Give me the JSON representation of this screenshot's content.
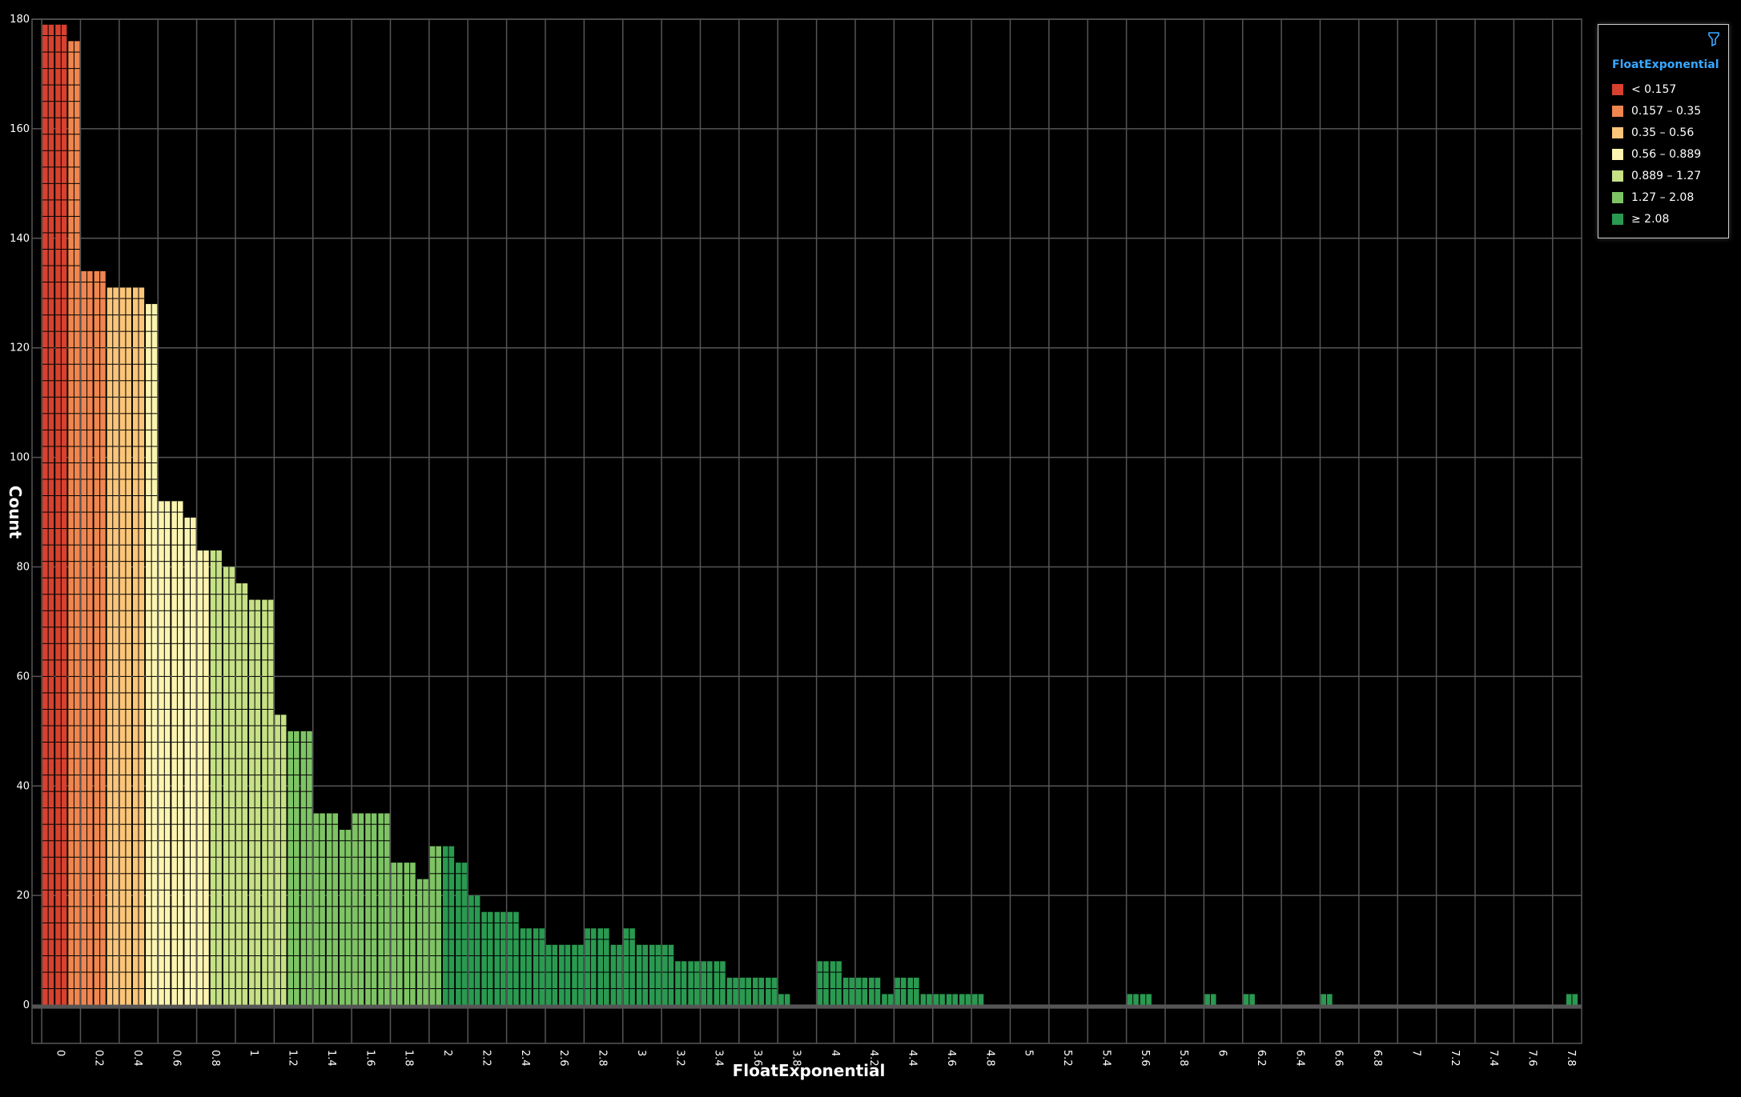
{
  "chart_data": {
    "type": "bar",
    "title": "",
    "xlabel": "FloatExponential",
    "ylabel": "Count",
    "xlim": [
      -0.05,
      7.95
    ],
    "ylim": [
      -7,
      180
    ],
    "bin_width": 0.2,
    "grid": true,
    "legend_position": "top-right",
    "x_ticks": [
      "0",
      "0.2",
      "0.4",
      "0.6",
      "0.8",
      "1",
      "1.2",
      "1.4",
      "1.6",
      "1.8",
      "2",
      "2.2",
      "2.4",
      "2.6",
      "2.8",
      "3",
      "3.2",
      "3.4",
      "3.6",
      "3.8",
      "4",
      "4.2",
      "4.4",
      "4.6",
      "4.8",
      "5",
      "5.2",
      "5.4",
      "5.6",
      "5.8",
      "6",
      "6.2",
      "6.4",
      "6.6",
      "6.8",
      "7",
      "7.2",
      "7.4",
      "7.6",
      "7.8"
    ],
    "y_ticks": [
      0,
      20,
      40,
      60,
      80,
      100,
      120,
      140,
      160,
      180
    ],
    "bins": [
      {
        "x0": 0.0,
        "x1": 0.2,
        "counts": [
          179,
          179,
          176
        ]
      },
      {
        "x0": 0.2,
        "x1": 0.4,
        "counts": [
          134,
          134,
          131
        ]
      },
      {
        "x0": 0.4,
        "x1": 0.6,
        "counts": [
          131,
          131,
          128
        ]
      },
      {
        "x0": 0.6,
        "x1": 0.8,
        "counts": [
          92,
          92,
          89
        ]
      },
      {
        "x0": 0.8,
        "x1": 1.0,
        "counts": [
          83,
          83,
          80
        ]
      },
      {
        "x0": 1.0,
        "x1": 1.2,
        "counts": [
          77,
          74,
          74
        ]
      },
      {
        "x0": 1.2,
        "x1": 1.4,
        "counts": [
          53,
          50,
          50
        ]
      },
      {
        "x0": 1.4,
        "x1": 1.6,
        "counts": [
          35,
          35,
          32
        ]
      },
      {
        "x0": 1.6,
        "x1": 1.8,
        "counts": [
          35,
          35,
          35
        ]
      },
      {
        "x0": 1.8,
        "x1": 2.0,
        "counts": [
          26,
          26,
          23
        ]
      },
      {
        "x0": 2.0,
        "x1": 2.2,
        "counts": [
          29,
          29,
          26
        ]
      },
      {
        "x0": 2.2,
        "x1": 2.4,
        "counts": [
          20,
          17,
          17
        ]
      },
      {
        "x0": 2.4,
        "x1": 2.6,
        "counts": [
          17,
          14,
          14
        ]
      },
      {
        "x0": 2.6,
        "x1": 2.8,
        "counts": [
          11,
          11,
          11
        ]
      },
      {
        "x0": 2.8,
        "x1": 3.0,
        "counts": [
          14,
          14,
          11
        ]
      },
      {
        "x0": 3.0,
        "x1": 3.2,
        "counts": [
          14,
          11,
          11
        ]
      },
      {
        "x0": 3.2,
        "x1": 3.4,
        "counts": [
          11,
          8,
          8
        ]
      },
      {
        "x0": 3.4,
        "x1": 3.6,
        "counts": [
          8,
          8,
          5
        ]
      },
      {
        "x0": 3.6,
        "x1": 3.8,
        "counts": [
          5,
          5,
          5
        ]
      },
      {
        "x0": 3.8,
        "x1": 4.0,
        "counts": [
          2,
          0,
          0
        ]
      },
      {
        "x0": 4.0,
        "x1": 4.2,
        "counts": [
          8,
          8,
          5
        ]
      },
      {
        "x0": 4.2,
        "x1": 4.4,
        "counts": [
          5,
          5,
          2
        ]
      },
      {
        "x0": 4.4,
        "x1": 4.6,
        "counts": [
          5,
          5,
          2
        ]
      },
      {
        "x0": 4.6,
        "x1": 4.8,
        "counts": [
          2,
          2,
          2
        ]
      },
      {
        "x0": 4.8,
        "x1": 5.0,
        "counts": [
          2,
          0,
          0
        ]
      },
      {
        "x0": 5.0,
        "x1": 5.2,
        "counts": [
          0,
          0,
          0
        ]
      },
      {
        "x0": 5.2,
        "x1": 5.4,
        "counts": [
          0,
          0,
          0
        ]
      },
      {
        "x0": 5.4,
        "x1": 5.6,
        "counts": [
          0,
          0,
          0
        ]
      },
      {
        "x0": 5.6,
        "x1": 5.8,
        "counts": [
          2,
          2,
          0
        ]
      },
      {
        "x0": 5.8,
        "x1": 6.0,
        "counts": [
          0,
          0,
          0
        ]
      },
      {
        "x0": 6.0,
        "x1": 6.2,
        "counts": [
          2,
          0,
          0
        ]
      },
      {
        "x0": 6.2,
        "x1": 6.4,
        "counts": [
          2,
          0,
          0
        ]
      },
      {
        "x0": 6.4,
        "x1": 6.6,
        "counts": [
          0,
          0,
          0
        ]
      },
      {
        "x0": 6.6,
        "x1": 6.8,
        "counts": [
          2,
          0,
          0
        ]
      },
      {
        "x0": 6.8,
        "x1": 7.0,
        "counts": [
          0,
          0,
          0
        ]
      },
      {
        "x0": 7.0,
        "x1": 7.2,
        "counts": [
          0,
          0,
          0
        ]
      },
      {
        "x0": 7.2,
        "x1": 7.4,
        "counts": [
          0,
          0,
          0
        ]
      },
      {
        "x0": 7.4,
        "x1": 7.6,
        "counts": [
          0,
          0,
          0
        ]
      },
      {
        "x0": 7.6,
        "x1": 7.8,
        "counts": [
          0,
          0,
          0
        ]
      },
      {
        "x0": 7.8,
        "x1": 8.0,
        "counts": [
          0,
          2,
          0
        ]
      }
    ],
    "legend": {
      "title": "FloatExponential",
      "items": [
        {
          "label": "< 0.157",
          "color": "#d7412f",
          "min": null,
          "max": 0.157
        },
        {
          "label": "0.157 – 0.35",
          "color": "#f0864f",
          "min": 0.157,
          "max": 0.35
        },
        {
          "label": "0.35 – 0.56",
          "color": "#fbc57a",
          "min": 0.35,
          "max": 0.56
        },
        {
          "label": "0.56 – 0.889",
          "color": "#fcf4b0",
          "min": 0.56,
          "max": 0.889
        },
        {
          "label": "0.889 – 1.27",
          "color": "#c6e186",
          "min": 0.889,
          "max": 1.27
        },
        {
          "label": "1.27 – 2.08",
          "color": "#7ec465",
          "min": 1.27,
          "max": 2.08
        },
        {
          "label": "≥ 2.08",
          "color": "#2a9a51",
          "min": 2.08,
          "max": null
        }
      ]
    }
  },
  "colors": {
    "background": "#000000",
    "grid": "#555555",
    "cell_border": "#000000",
    "baseline": "#555555",
    "legend_title": "#3aa8ff",
    "filter_icon": "#3aa8ff"
  },
  "icons": {
    "legend_filter": "filter-funnel-icon"
  }
}
